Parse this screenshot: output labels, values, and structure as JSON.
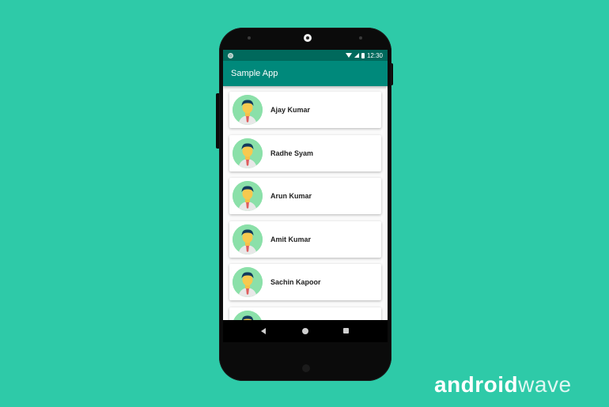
{
  "status_bar": {
    "time": "12:30"
  },
  "app_bar": {
    "title": "Sample App"
  },
  "contacts": [
    {
      "name": "Ajay Kumar"
    },
    {
      "name": "Radhe Syam"
    },
    {
      "name": "Arun Kumar"
    },
    {
      "name": "Amit Kumar"
    },
    {
      "name": "Sachin Kapoor"
    },
    {
      "name": ""
    }
  ],
  "watermark": {
    "part1": "android",
    "part2": "wave"
  },
  "colors": {
    "background": "#2ecaa8",
    "primary": "#00897b",
    "primary_dark": "#00695c",
    "avatar_bg": "#8be0a9"
  },
  "icons": {
    "avatar": "person-avatar-icon",
    "wifi": "wifi-icon",
    "signal": "signal-icon",
    "battery": "battery-icon"
  }
}
